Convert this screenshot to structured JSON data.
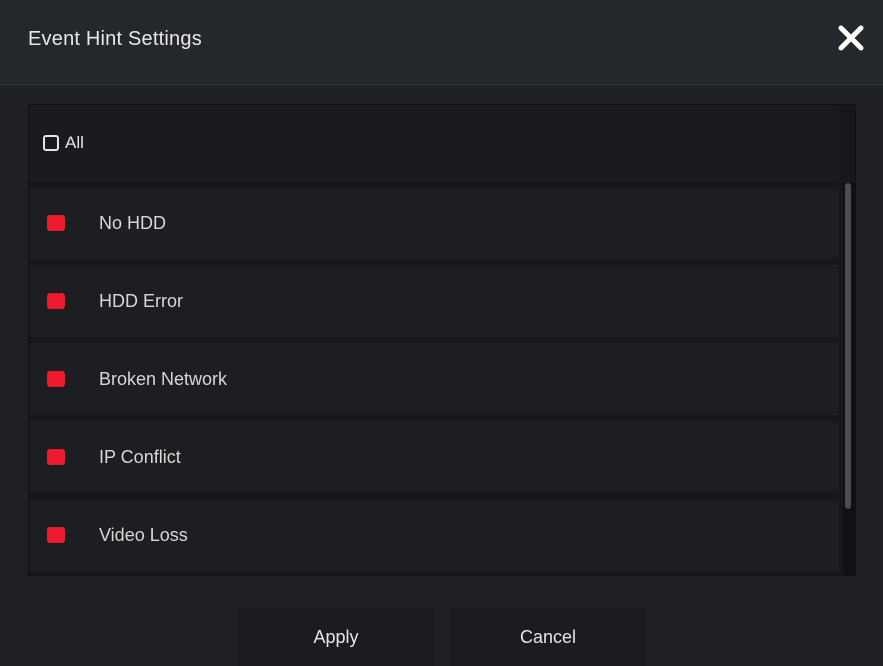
{
  "dialog": {
    "title": "Event Hint Settings",
    "close_icon": "close-icon"
  },
  "select_all": {
    "label": "All",
    "checked": false
  },
  "events": [
    {
      "label": "No HDD",
      "enabled": true
    },
    {
      "label": "HDD Error",
      "enabled": true
    },
    {
      "label": "Broken Network",
      "enabled": true
    },
    {
      "label": "IP Conflict",
      "enabled": true
    },
    {
      "label": "Video Loss",
      "enabled": true
    }
  ],
  "buttons": {
    "apply": "Apply",
    "cancel": "Cancel"
  },
  "colors": {
    "indicator_on": "#ec1a2c",
    "background": "#1e2024"
  }
}
